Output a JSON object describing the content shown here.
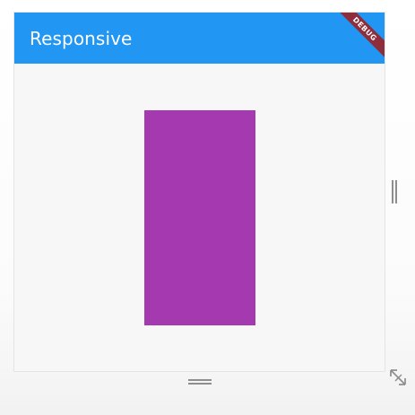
{
  "app": {
    "title": "Responsive",
    "debug_banner": "DEBUG"
  },
  "colors": {
    "app_bar": "#2196f3",
    "box": "#a439b0",
    "debug_banner": "#8e2d3b",
    "background": "#f7f7f7"
  },
  "icons": {
    "right_handle": "vertical-resize-handle-icon",
    "bottom_handle": "horizontal-resize-handle-icon",
    "corner_handle": "diagonal-resize-icon"
  }
}
